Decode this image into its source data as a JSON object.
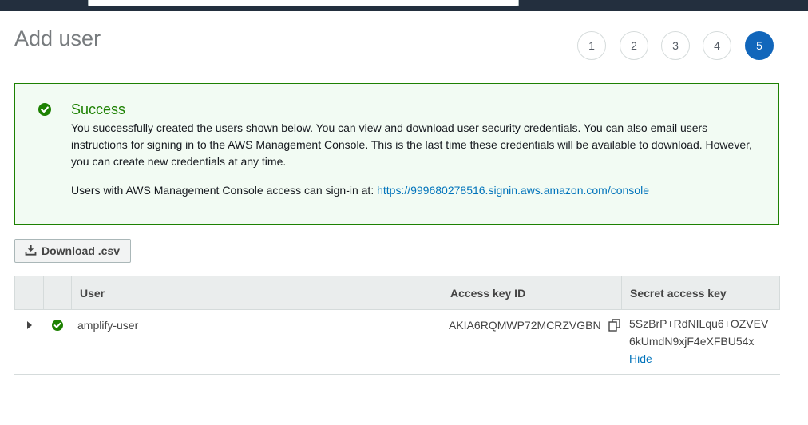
{
  "page": {
    "title": "Add user"
  },
  "steps": [
    "1",
    "2",
    "3",
    "4",
    "5"
  ],
  "active_step": "5",
  "alert": {
    "title": "Success",
    "message": "You successfully created the users shown below. You can view and download user security credentials. You can also email users instructions for signing in to the AWS Management Console. This is the last time these credentials will be available to download. However, you can create new credentials at any time.",
    "signin_text": "Users with AWS Management Console access can sign-in at: ",
    "signin_url": "https://999680278516.signin.aws.amazon.com/console"
  },
  "toolbar": {
    "download_label": "Download .csv"
  },
  "table": {
    "columns": {
      "user": "User",
      "access_key": "Access key ID",
      "secret_key": "Secret access key"
    },
    "rows": [
      {
        "user": "amplify-user",
        "access_key_id": "AKIA6RQMWP72MCRZVGBN",
        "secret_line1": "5SzBrP+RdNILqu6+OZVEV",
        "secret_line2": "6kUmdN9xjF4eXFBU54x",
        "hide_label": "Hide"
      }
    ]
  },
  "colors": {
    "success": "#1d8102",
    "accent": "#1166bb",
    "link": "#0073bb",
    "header_bg": "#232f3e"
  },
  "icons": [
    "check-circle-icon",
    "download-icon",
    "copy-icon",
    "caret-right-icon"
  ]
}
